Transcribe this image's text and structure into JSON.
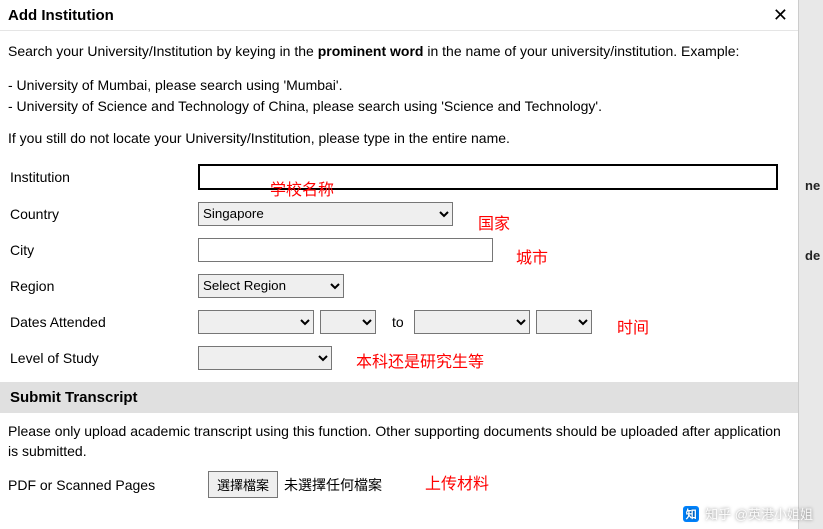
{
  "dialog": {
    "title": "Add Institution",
    "intro_pre": "Search your University/Institution by keying in the ",
    "intro_bold": "prominent word",
    "intro_post": " in the name of your university/institution. Example:",
    "ex1_pre": "- University of Mumbai, please search using '",
    "ex1_u": "Mumbai",
    "ex1_post": "'.",
    "ex2_pre": "- University of Science and Technology of China, please search using '",
    "ex2_u": "Science and Technology",
    "ex2_post": "'.",
    "still": "If you still do not locate your University/Institution, please type in the entire name."
  },
  "labels": {
    "institution": "Institution",
    "country": "Country",
    "city": "City",
    "region": "Region",
    "dates": "Dates Attended",
    "to": "to",
    "level": "Level of Study",
    "pdf": "PDF or Scanned Pages"
  },
  "fields": {
    "institution_value": "",
    "country_selected": "Singapore",
    "city_value": "",
    "region_selected": "Select Region",
    "date_from_month": "",
    "date_from_year": "",
    "date_to_month": "",
    "date_to_year": "",
    "level_selected": "",
    "file_button": "選擇檔案",
    "file_status": "未選擇任何檔案"
  },
  "section": {
    "submit_title": "Submit Transcript",
    "submit_desc": "Please only upload academic transcript using this function. Other supporting documents should be uploaded after application is submitted."
  },
  "annotations": {
    "school": "学校名称",
    "country": "国家",
    "city": "城市",
    "dates": "时间",
    "level": "本科还是研究生等",
    "upload": "上传材料"
  },
  "right_hints": {
    "a": "ne",
    "b": "de"
  },
  "watermark": {
    "logo": "知",
    "text": "知乎 @英港小姐姐"
  }
}
